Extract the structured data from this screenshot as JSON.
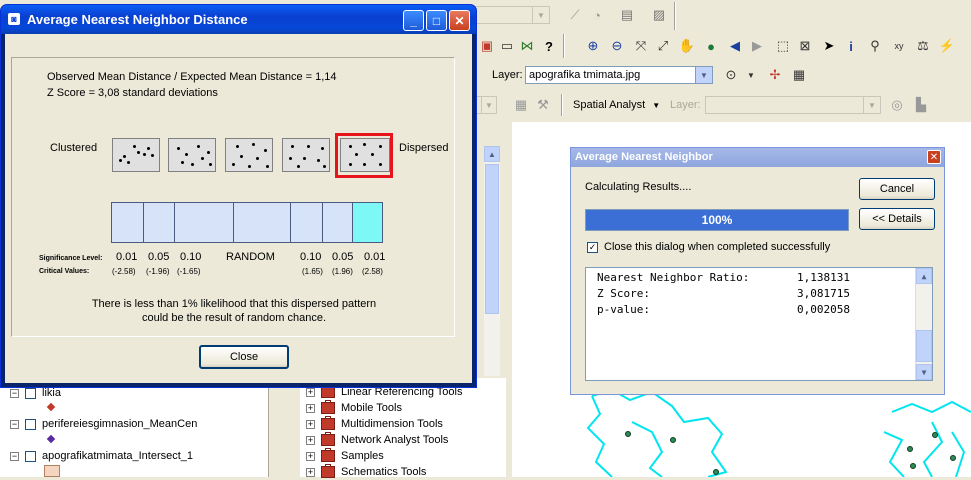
{
  "main_dialog": {
    "title": "Average Nearest Neighbor Distance",
    "ratio_text": "Observed Mean Distance / Expected Mean Distance = 1,14",
    "zscore_text": "Z Score = 3,08 standard deviations",
    "clustered_label": "Clustered",
    "dispersed_label": "Dispersed",
    "significance_label": "Significance Level:",
    "critical_label": "Critical Values:",
    "significance_values": [
      "0.01",
      "0.05",
      "0.10",
      "RANDOM",
      "0.10",
      "0.05",
      "0.01"
    ],
    "critical_values": [
      "(-2.58)",
      "(-1.96)",
      "(-1.65)",
      "",
      "(1.65)",
      "(1.96)",
      "(2.58)"
    ],
    "message_line1": "There is less than 1% likelihood that this dispersed pattern",
    "message_line2": "could be the result of random chance.",
    "close_label": "Close",
    "highlight_color": "#e8141c",
    "active_cell_color": "#7ef7f7"
  },
  "progress_dialog": {
    "title": "Average Nearest Neighbor",
    "status": "Calculating Results....",
    "cancel_label": "Cancel",
    "details_label": "<< Details",
    "progress_text": "100%",
    "progress_value": 100,
    "checkbox_label": "Close this dialog when completed successfully",
    "checkbox_checked": true,
    "results": [
      {
        "label": "Nearest Neighbor Ratio:",
        "value": "1,138131"
      },
      {
        "label": "Z Score:",
        "value": "3,081715"
      },
      {
        "label": "p-value:",
        "value": "0,002058"
      }
    ]
  },
  "toolbar": {
    "layer_label": "Layer:",
    "layer_value": "apografika tmimata.jpg",
    "spatial_analyst_label": "Spatial Analyst",
    "layer2_label": "Layer:"
  },
  "toc": {
    "items": [
      {
        "label": "likia"
      },
      {
        "label": "perifereiesgimnasion_MeanCen"
      },
      {
        "label": "apografikatmimata_Intersect_1"
      }
    ]
  },
  "toolbox": {
    "items": [
      {
        "label": "Linear Referencing Tools"
      },
      {
        "label": "Mobile Tools"
      },
      {
        "label": "Multidimension Tools"
      },
      {
        "label": "Network Analyst Tools"
      },
      {
        "label": "Samples"
      },
      {
        "label": "Schematics Tools"
      }
    ]
  },
  "colors": {
    "map_polygon": "#00e5ee",
    "map_point": "#2e8b57"
  }
}
